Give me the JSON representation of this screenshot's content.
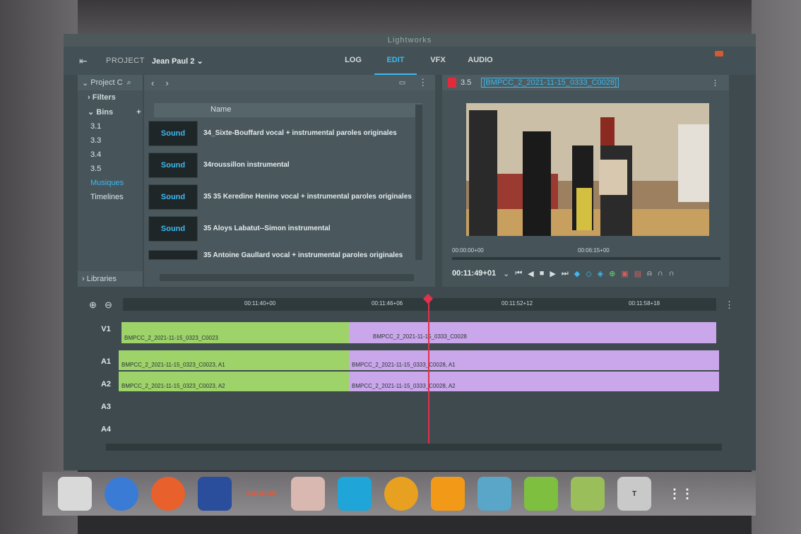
{
  "app": {
    "title": "Lightworks"
  },
  "topbar": {
    "project_label": "PROJECT",
    "project_name": "Jean Paul 2",
    "tabs": [
      "LOG",
      "EDIT",
      "VFX",
      "AUDIO"
    ],
    "active_tab": "EDIT"
  },
  "left_panel": {
    "header": "Project C",
    "filters": "Filters",
    "bins_label": "Bins",
    "bins": [
      "3.1",
      "3.3",
      "3.4",
      "3.5",
      "Musiques",
      "Timelines"
    ],
    "selected_bin": "Musiques",
    "libraries": "Libraries"
  },
  "bin": {
    "column_name": "Name",
    "rows": [
      {
        "thumb": "Sound",
        "name": "34_Sixte-Bouffard vocal + instrumental paroles originales"
      },
      {
        "thumb": "Sound",
        "name": "34roussillon instrumental"
      },
      {
        "thumb": "Sound",
        "name": "35 35 Keredine Henine vocal + instrumental paroles originales"
      },
      {
        "thumb": "Sound",
        "name": "35 Aloys Labatut--Simon instrumental"
      },
      {
        "thumb": "",
        "name": "35 Antoine Gaullard vocal + instrumental paroles originales"
      }
    ]
  },
  "viewer": {
    "bin_id": "3.5",
    "clip_name": "[BMPCC_2_2021-11-15_0333_C0028]",
    "tc_start": "00:00:00+00",
    "tc_mid": "00:06:15+00",
    "current_tc": "00:11:49+01"
  },
  "timeline": {
    "ruler": [
      "00:11:40+00",
      "00:11:46+06",
      "00:11:52+12",
      "00:11:58+18"
    ],
    "tracks": [
      "V1",
      "A1",
      "A2",
      "A3",
      "A4"
    ],
    "v1_clips": [
      "BMPCC_2_2021-11-15_0323_C0023",
      "BMPCC_2_2021-11-15_0333_C0028"
    ],
    "a1_clips": [
      "BMPCC_2_2021-11-15_0323_C0023, A1",
      "BMPCC_2_2021-11-15_0333_C0028, A1"
    ],
    "a2_clips": [
      "BMPCC_2_2021-11-15_0323_C0023, A2",
      "BMPCC_2_2021-11-15_0333_C0028, A2"
    ]
  },
  "taskbar": {
    "apps": [
      "files-icon",
      "thunderbird-icon",
      "firefox-icon",
      "audacity-icon",
      "ardour-icon",
      "presenter-icon",
      "tiles-icon",
      "camera-icon",
      "vlc-icon",
      "screenshot-icon",
      "image-icon",
      "shotwell-icon",
      "typora-icon",
      "apps-grid-icon"
    ],
    "ardour_label": "ARDOUR"
  }
}
